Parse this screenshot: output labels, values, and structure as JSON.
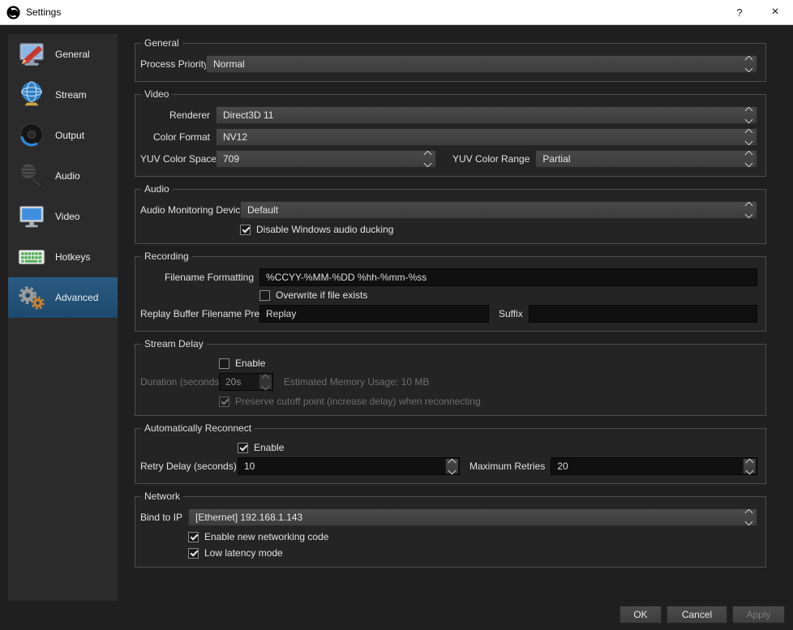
{
  "window": {
    "title": "Settings",
    "help_label": "?",
    "close_label": "×"
  },
  "sidebar": {
    "items": [
      {
        "label": "General"
      },
      {
        "label": "Stream"
      },
      {
        "label": "Output"
      },
      {
        "label": "Audio"
      },
      {
        "label": "Video"
      },
      {
        "label": "Hotkeys"
      },
      {
        "label": "Advanced"
      }
    ]
  },
  "general": {
    "title": "General",
    "process_priority_label": "Process Priority",
    "process_priority_value": "Normal"
  },
  "video": {
    "title": "Video",
    "renderer_label": "Renderer",
    "renderer_value": "Direct3D 11",
    "color_format_label": "Color Format",
    "color_format_value": "NV12",
    "yuv_space_label": "YUV Color Space",
    "yuv_space_value": "709",
    "yuv_range_label": "YUV Color Range",
    "yuv_range_value": "Partial"
  },
  "audio": {
    "title": "Audio",
    "monitoring_device_label": "Audio Monitoring Device",
    "monitoring_device_value": "Default",
    "ducking_label": "Disable Windows audio ducking",
    "ducking_checked": true
  },
  "recording": {
    "title": "Recording",
    "filename_label": "Filename Formatting",
    "filename_value": "%CCYY-%MM-%DD %hh-%mm-%ss",
    "overwrite_label": "Overwrite if file exists",
    "overwrite_checked": false,
    "replay_prefix_label": "Replay Buffer Filename Prefix",
    "replay_prefix_value": "Replay",
    "suffix_label": "Suffix",
    "suffix_value": ""
  },
  "stream_delay": {
    "title": "Stream Delay",
    "enable_label": "Enable",
    "enable_checked": false,
    "duration_label": "Duration (seconds)",
    "duration_value": "20s",
    "memory_usage_label": "Estimated Memory Usage: 10 MB",
    "preserve_label": "Preserve cutoff point (increase delay) when reconnecting",
    "preserve_checked": true
  },
  "reconnect": {
    "title": "Automatically Reconnect",
    "enable_label": "Enable",
    "enable_checked": true,
    "retry_delay_label": "Retry Delay (seconds)",
    "retry_delay_value": "10",
    "max_retries_label": "Maximum Retries",
    "max_retries_value": "20"
  },
  "network": {
    "title": "Network",
    "bind_ip_label": "Bind to IP",
    "bind_ip_value": "[Ethernet] 192.168.1.143",
    "new_code_label": "Enable new networking code",
    "new_code_checked": true,
    "low_latency_label": "Low latency mode",
    "low_latency_checked": true
  },
  "footer": {
    "ok_label": "OK",
    "cancel_label": "Cancel",
    "apply_label": "Apply"
  },
  "colors": {
    "titlebar_bg": "#ffffff",
    "body_bg": "#1f1f1f",
    "sidebar_bg": "#2b2b2b",
    "sidebar_selected": "#1d4a6e",
    "group_bg": "#242424",
    "group_border": "#4d4d4d"
  }
}
